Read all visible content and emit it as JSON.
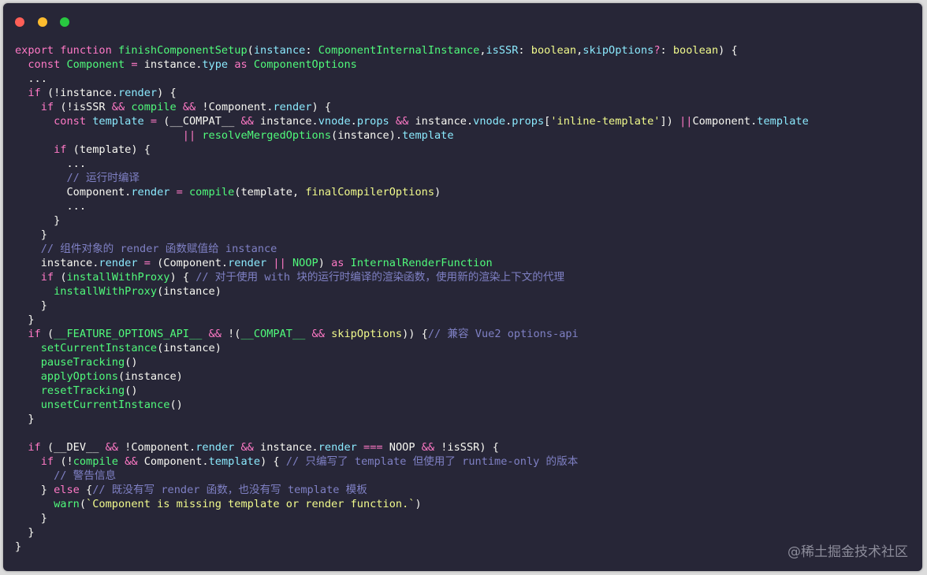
{
  "window": {
    "buttons": [
      "close",
      "minimize",
      "maximize"
    ]
  },
  "colors": {
    "background": "#272637",
    "keyword": "#ff79c6",
    "function": "#50fa7b",
    "property": "#8be9fd",
    "string": "#f1fa8c",
    "comment": "#7f80c4",
    "text": "#f8f8f2"
  },
  "code": {
    "language": "typescript",
    "lines": [
      [
        [
          "kw",
          "export "
        ],
        [
          "kw",
          "function "
        ],
        [
          "fn",
          "finishComponentSetup"
        ],
        [
          "pl",
          "("
        ],
        [
          "pr",
          "instance"
        ],
        [
          "pl",
          ": "
        ],
        [
          "fn",
          "ComponentInternalInstance"
        ],
        [
          "pl",
          ","
        ],
        [
          "pr",
          "isSSR"
        ],
        [
          "pl",
          ": "
        ],
        [
          "st",
          "boolean"
        ],
        [
          "pl",
          ","
        ],
        [
          "pr",
          "skipOptions"
        ],
        [
          "op",
          "?"
        ],
        [
          "pl",
          ": "
        ],
        [
          "st",
          "boolean"
        ],
        [
          "pl",
          ") {"
        ]
      ],
      [
        [
          "pl",
          "  "
        ],
        [
          "kw",
          "const "
        ],
        [
          "fn",
          "Component"
        ],
        [
          "pl",
          " "
        ],
        [
          "op",
          "="
        ],
        [
          "pl",
          " instance."
        ],
        [
          "pr",
          "type"
        ],
        [
          "pl",
          " "
        ],
        [
          "kw",
          "as "
        ],
        [
          "fn",
          "ComponentOptions"
        ]
      ],
      [
        [
          "pl",
          "  ..."
        ]
      ],
      [
        [
          "pl",
          "  "
        ],
        [
          "kw",
          "if "
        ],
        [
          "pl",
          "(!instance."
        ],
        [
          "pr",
          "render"
        ],
        [
          "pl",
          ") {"
        ]
      ],
      [
        [
          "pl",
          "    "
        ],
        [
          "kw",
          "if "
        ],
        [
          "pl",
          "(!isSSR "
        ],
        [
          "op",
          "&&"
        ],
        [
          "pl",
          " "
        ],
        [
          "fn",
          "compile"
        ],
        [
          "pl",
          " "
        ],
        [
          "op",
          "&&"
        ],
        [
          "pl",
          " !Component."
        ],
        [
          "pr",
          "render"
        ],
        [
          "pl",
          ") {"
        ]
      ],
      [
        [
          "pl",
          "      "
        ],
        [
          "kw",
          "const "
        ],
        [
          "pr",
          "template"
        ],
        [
          "pl",
          " "
        ],
        [
          "op",
          "="
        ],
        [
          "pl",
          " (__COMPAT__ "
        ],
        [
          "op",
          "&&"
        ],
        [
          "pl",
          " instance."
        ],
        [
          "pr",
          "vnode"
        ],
        [
          "pl",
          "."
        ],
        [
          "pr",
          "props"
        ],
        [
          "pl",
          " "
        ],
        [
          "op",
          "&&"
        ],
        [
          "pl",
          " instance."
        ],
        [
          "pr",
          "vnode"
        ],
        [
          "pl",
          "."
        ],
        [
          "pr",
          "props"
        ],
        [
          "pl",
          "["
        ],
        [
          "st",
          "'inline-template'"
        ],
        [
          "pl",
          "]) "
        ],
        [
          "op",
          "||"
        ],
        [
          "pl",
          "Component."
        ],
        [
          "pr",
          "template"
        ]
      ],
      [
        [
          "pl",
          "                          "
        ],
        [
          "op",
          "||"
        ],
        [
          "pl",
          " "
        ],
        [
          "fn",
          "resolveMergedOptions"
        ],
        [
          "pl",
          "(instance)."
        ],
        [
          "pr",
          "template"
        ]
      ],
      [
        [
          "pl",
          "      "
        ],
        [
          "kw",
          "if "
        ],
        [
          "pl",
          "(template) {"
        ]
      ],
      [
        [
          "pl",
          "        ..."
        ]
      ],
      [
        [
          "pl",
          "        "
        ],
        [
          "cm",
          "// 运行时编译"
        ]
      ],
      [
        [
          "pl",
          "        Component."
        ],
        [
          "pr",
          "render"
        ],
        [
          "pl",
          " "
        ],
        [
          "op",
          "="
        ],
        [
          "pl",
          " "
        ],
        [
          "fn",
          "compile"
        ],
        [
          "pl",
          "(template, "
        ],
        [
          "st",
          "finalCompilerOptions"
        ],
        [
          "pl",
          ")"
        ]
      ],
      [
        [
          "pl",
          "        ..."
        ]
      ],
      [
        [
          "pl",
          "      }"
        ]
      ],
      [
        [
          "pl",
          "    }"
        ]
      ],
      [
        [
          "pl",
          "    "
        ],
        [
          "cm",
          "// 组件对象的 render 函数赋值给 instance"
        ]
      ],
      [
        [
          "pl",
          "    instance."
        ],
        [
          "pr",
          "render"
        ],
        [
          "pl",
          " "
        ],
        [
          "op",
          "="
        ],
        [
          "pl",
          " (Component."
        ],
        [
          "pr",
          "render"
        ],
        [
          "pl",
          " "
        ],
        [
          "op",
          "||"
        ],
        [
          "pl",
          " "
        ],
        [
          "fn",
          "NOOP"
        ],
        [
          "pl",
          ") "
        ],
        [
          "kw",
          "as "
        ],
        [
          "fn",
          "InternalRenderFunction"
        ]
      ],
      [
        [
          "pl",
          "    "
        ],
        [
          "kw",
          "if "
        ],
        [
          "pl",
          "("
        ],
        [
          "fn",
          "installWithProxy"
        ],
        [
          "pl",
          ") { "
        ],
        [
          "cm",
          "// 对于使用 with 块的运行时编译的渲染函数，使用新的渲染上下文的代理"
        ]
      ],
      [
        [
          "pl",
          "      "
        ],
        [
          "fn",
          "installWithProxy"
        ],
        [
          "pl",
          "(instance)"
        ]
      ],
      [
        [
          "pl",
          "    }"
        ]
      ],
      [
        [
          "pl",
          "  }"
        ]
      ],
      [
        [
          "pl",
          "  "
        ],
        [
          "kw",
          "if "
        ],
        [
          "pl",
          "("
        ],
        [
          "fn",
          "__FEATURE_OPTIONS_API__"
        ],
        [
          "pl",
          " "
        ],
        [
          "op",
          "&&"
        ],
        [
          "pl",
          " !("
        ],
        [
          "fn",
          "__COMPAT__"
        ],
        [
          "pl",
          " "
        ],
        [
          "op",
          "&&"
        ],
        [
          "pl",
          " "
        ],
        [
          "st",
          "skipOptions"
        ],
        [
          "pl",
          ")) {"
        ],
        [
          "cm",
          "// 兼容 Vue2 options-api"
        ]
      ],
      [
        [
          "pl",
          "    "
        ],
        [
          "fn",
          "setCurrentInstance"
        ],
        [
          "pl",
          "(instance)"
        ]
      ],
      [
        [
          "pl",
          "    "
        ],
        [
          "fn",
          "pauseTracking"
        ],
        [
          "pl",
          "()"
        ]
      ],
      [
        [
          "pl",
          "    "
        ],
        [
          "fn",
          "applyOptions"
        ],
        [
          "pl",
          "(instance)"
        ]
      ],
      [
        [
          "pl",
          "    "
        ],
        [
          "fn",
          "resetTracking"
        ],
        [
          "pl",
          "()"
        ]
      ],
      [
        [
          "pl",
          "    "
        ],
        [
          "fn",
          "unsetCurrentInstance"
        ],
        [
          "pl",
          "()"
        ]
      ],
      [
        [
          "pl",
          "  }"
        ]
      ],
      [
        [
          "pl",
          ""
        ]
      ],
      [
        [
          "pl",
          "  "
        ],
        [
          "kw",
          "if "
        ],
        [
          "pl",
          "(__DEV__ "
        ],
        [
          "op",
          "&&"
        ],
        [
          "pl",
          " !Component."
        ],
        [
          "pr",
          "render"
        ],
        [
          "pl",
          " "
        ],
        [
          "op",
          "&&"
        ],
        [
          "pl",
          " instance."
        ],
        [
          "pr",
          "render"
        ],
        [
          "pl",
          " "
        ],
        [
          "op",
          "==="
        ],
        [
          "pl",
          " NOOP "
        ],
        [
          "op",
          "&&"
        ],
        [
          "pl",
          " !isSSR) {"
        ]
      ],
      [
        [
          "pl",
          "    "
        ],
        [
          "kw",
          "if "
        ],
        [
          "pl",
          "(!"
        ],
        [
          "fn",
          "compile"
        ],
        [
          "pl",
          " "
        ],
        [
          "op",
          "&&"
        ],
        [
          "pl",
          " Component."
        ],
        [
          "pr",
          "template"
        ],
        [
          "pl",
          ") { "
        ],
        [
          "cm",
          "// 只编写了 template 但使用了 runtime-only 的版本"
        ]
      ],
      [
        [
          "pl",
          "      "
        ],
        [
          "cm",
          "// 警告信息"
        ]
      ],
      [
        [
          "pl",
          "    } "
        ],
        [
          "kw",
          "else "
        ],
        [
          "pl",
          "{"
        ],
        [
          "cm",
          "// 既没有写 render 函数，也没有写 template 模板"
        ]
      ],
      [
        [
          "pl",
          "      "
        ],
        [
          "fn",
          "warn"
        ],
        [
          "pl",
          "("
        ],
        [
          "st",
          "`Component is missing template or render function.`"
        ],
        [
          "pl",
          ")"
        ]
      ],
      [
        [
          "pl",
          "    }"
        ]
      ],
      [
        [
          "pl",
          "  }"
        ]
      ],
      [
        [
          "pl",
          "}"
        ]
      ]
    ]
  },
  "watermark": "@稀土掘金技术社区"
}
